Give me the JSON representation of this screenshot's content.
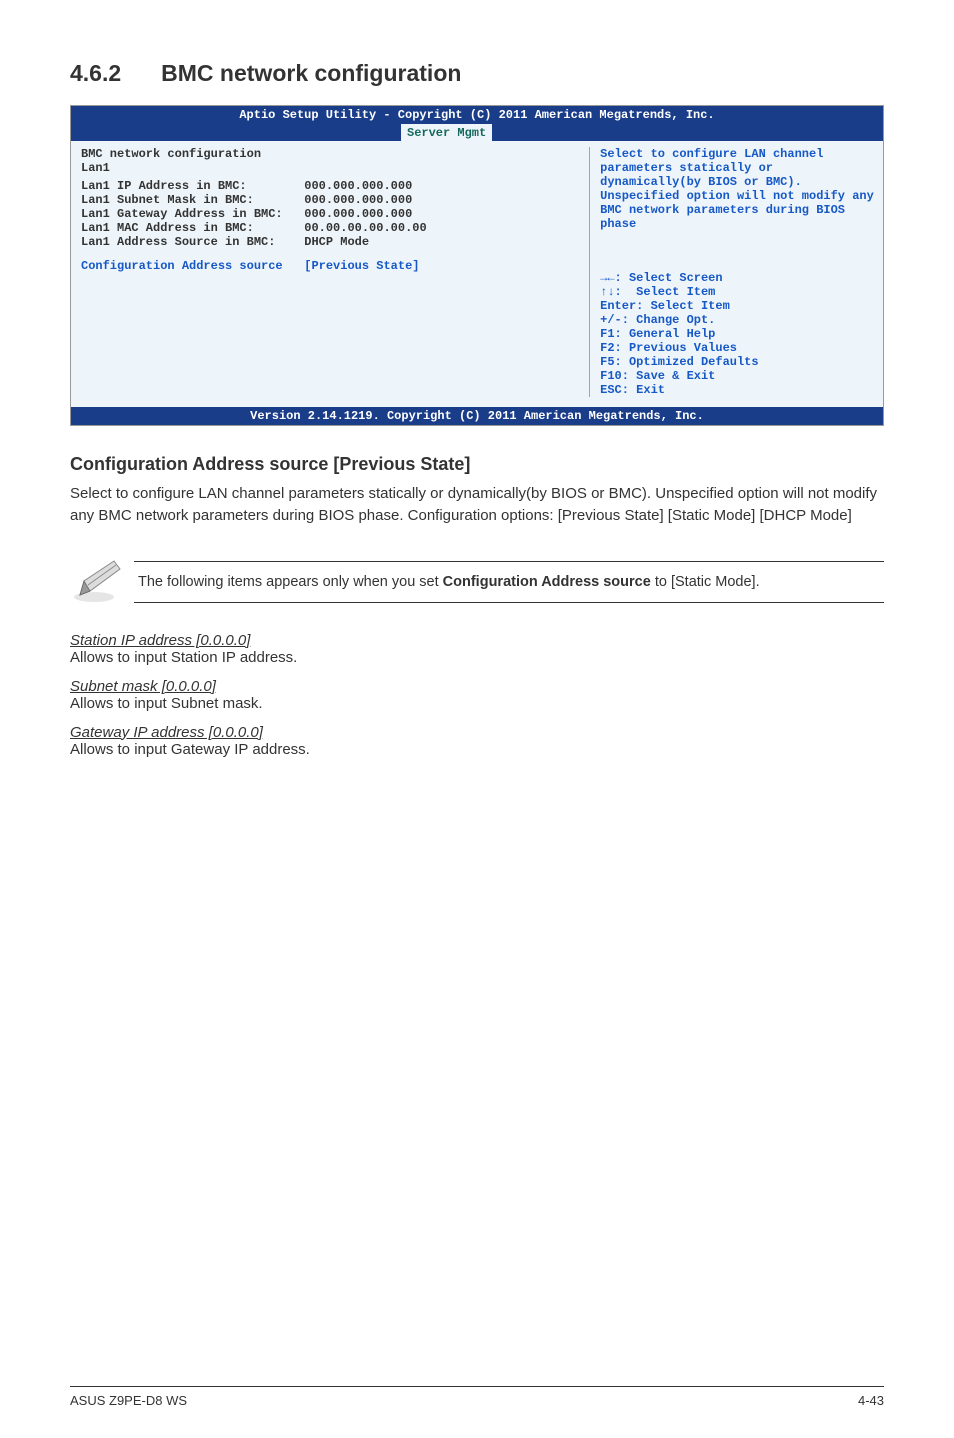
{
  "section": {
    "number": "4.6.2",
    "title": "BMC network configuration"
  },
  "bios": {
    "header": "Aptio Setup Utility - Copyright (C) 2011 American Megatrends, Inc.",
    "footer": "Version 2.14.1219. Copyright (C) 2011 American Megatrends, Inc.",
    "tab": "Server Mgmt",
    "left": {
      "title": "BMC network configuration",
      "lan_label": "Lan1",
      "rows": [
        {
          "label": "Lan1 IP Address in BMC:",
          "value": "000.000.000.000"
        },
        {
          "label": "Lan1 Subnet Mask in BMC:",
          "value": "000.000.000.000"
        },
        {
          "label": "Lan1 Gateway Address in BMC:",
          "value": "000.000.000.000"
        },
        {
          "label": "Lan1 MAC Address in BMC:",
          "value": "00.00.00.00.00.00"
        },
        {
          "label": "Lan1 Address Source in BMC:",
          "value": "DHCP Mode"
        }
      ],
      "config_label": "Configuration Address source",
      "config_value": "[Previous State]"
    },
    "right": {
      "help": "Select to configure LAN channel parameters statically or dynamically(by BIOS or BMC). Unspecified option will not modify any BMC network parameters during BIOS phase",
      "keys": [
        "→←: Select Screen",
        "↑↓:  Select Item",
        "Enter: Select Item",
        "+/-: Change Opt.",
        "F1: General Help",
        "F2: Previous Values",
        "F5: Optimized Defaults",
        "F10: Save & Exit",
        "ESC: Exit"
      ]
    }
  },
  "config_section": {
    "heading": "Configuration Address source [Previous State]",
    "body": "Select to configure LAN channel parameters statically or dynamically(by BIOS or BMC). Unspecified option will not modify any BMC network parameters during BIOS phase. Configuration options: [Previous State] [Static Mode] [DHCP Mode]"
  },
  "note": {
    "prefix": "The following items appears only when you set ",
    "bold": "Configuration Address source",
    "suffix": " to [Static Mode]."
  },
  "items": [
    {
      "title": "Station IP address [0.0.0.0]",
      "body": "Allows to input Station IP address."
    },
    {
      "title": "Subnet mask [0.0.0.0]",
      "body": "Allows to input Subnet mask."
    },
    {
      "title": "Gateway IP address [0.0.0.0]",
      "body": "Allows to input Gateway IP address."
    }
  ],
  "footer": {
    "left": "ASUS Z9PE-D8 WS",
    "right": "4-43"
  }
}
